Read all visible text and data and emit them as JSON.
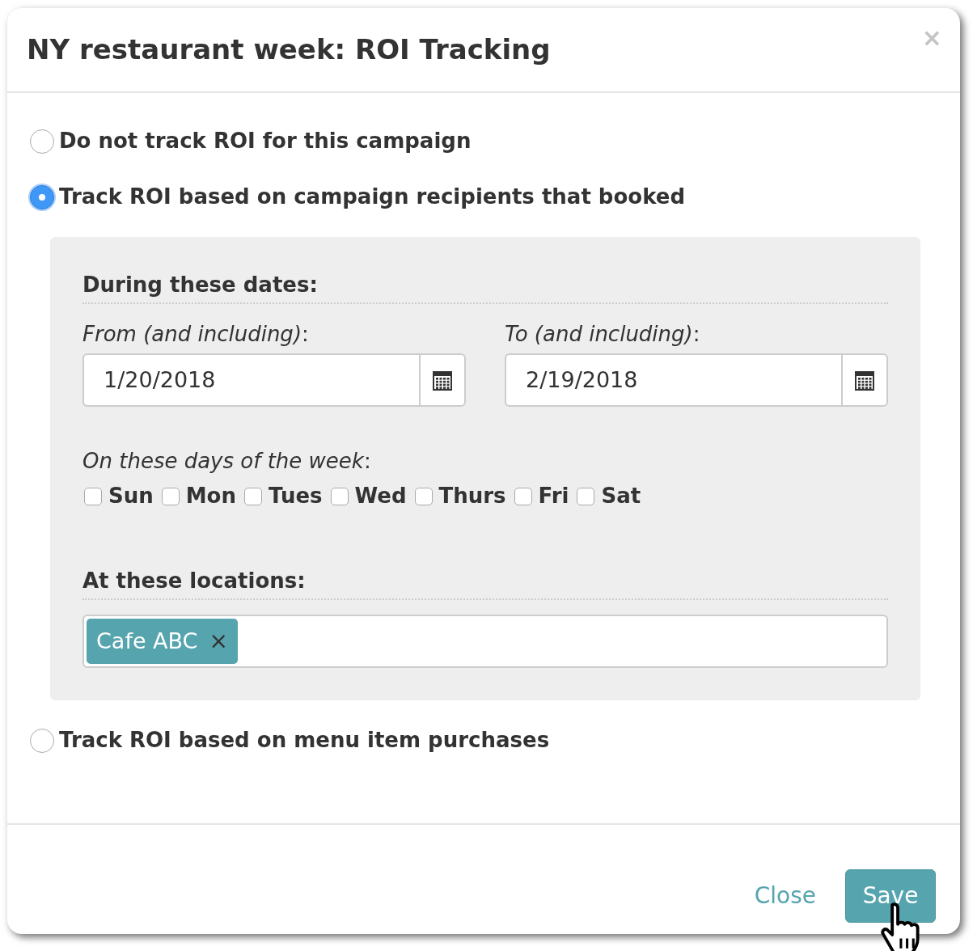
{
  "dialog": {
    "title": "NY restaurant week: ROI Tracking",
    "close_glyph": "×"
  },
  "options": [
    {
      "label": "Do not track ROI for this campaign",
      "selected": false
    },
    {
      "label": "Track ROI based on campaign recipients that booked",
      "selected": true
    },
    {
      "label": "Track ROI based on menu item purchases",
      "selected": false
    }
  ],
  "panel": {
    "dates_heading": "During these dates:",
    "from": {
      "label": "*From (and including)*:",
      "value": "1/20/2018"
    },
    "to": {
      "label": "*To (and including)*:",
      "value": "2/19/2018"
    },
    "days_label": "*On these days of the week*:",
    "days": [
      {
        "label": "Sun",
        "checked": false
      },
      {
        "label": "Mon",
        "checked": false
      },
      {
        "label": "Tues",
        "checked": false
      },
      {
        "label": "Wed",
        "checked": false
      },
      {
        "label": "Thurs",
        "checked": false
      },
      {
        "label": "Fri",
        "checked": false
      },
      {
        "label": "Sat",
        "checked": false
      }
    ],
    "locations_heading": "At these locations:",
    "locations": [
      {
        "label": "Cafe ABC",
        "remove_glyph": "×"
      }
    ]
  },
  "buttons": [
    {
      "label": "Close",
      "kind": "link"
    },
    {
      "label": "Save",
      "kind": "primary"
    }
  ]
}
